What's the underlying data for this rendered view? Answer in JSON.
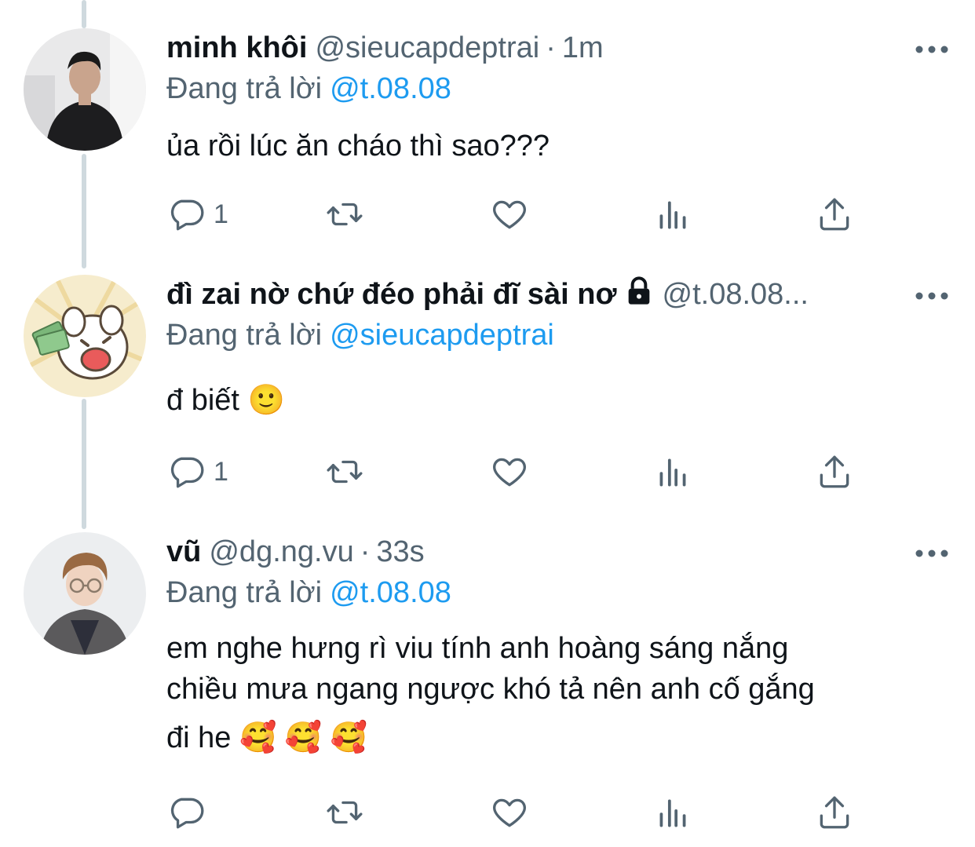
{
  "reply_prefix": "Đang trả lời",
  "tweets": [
    {
      "name": "minh khôi",
      "handle": "@sieucapdeptrai",
      "separator": "·",
      "time": "1m",
      "reply_to": "@t.08.08",
      "text_lines": [
        "ủa rồi lúc ăn cháo thì sao???"
      ],
      "reply_count": "1",
      "avatar_icon": "avatar-photo-man-dark"
    },
    {
      "name": "đì zai nờ chứ đéo phải đĩ sài nơ",
      "handle": "@t.08.08...",
      "reply_to": "@sieucapdeptrai",
      "text_lines": [
        "đ biết 🙂"
      ],
      "reply_count": "1",
      "protected_icon": "lock-icon",
      "avatar_icon": "avatar-cartoon-dog-money"
    },
    {
      "name": "vũ",
      "handle": "@dg.ng.vu",
      "separator": "·",
      "time": "33s",
      "reply_to": "@t.08.08",
      "text_lines": [
        "em nghe hưng rì viu tính anh hoàng sáng nắng",
        "chiều mưa ngang ngược khó tả nên anh cố gắng",
        "đi he 🥰 🥰 🥰"
      ],
      "reply_count": "",
      "avatar_icon": "avatar-photo-man-glasses"
    }
  ],
  "colors": {
    "text": "#0f1419",
    "secondary": "#536471",
    "link": "#1d9bf0",
    "thread_line": "#cfd9de"
  }
}
